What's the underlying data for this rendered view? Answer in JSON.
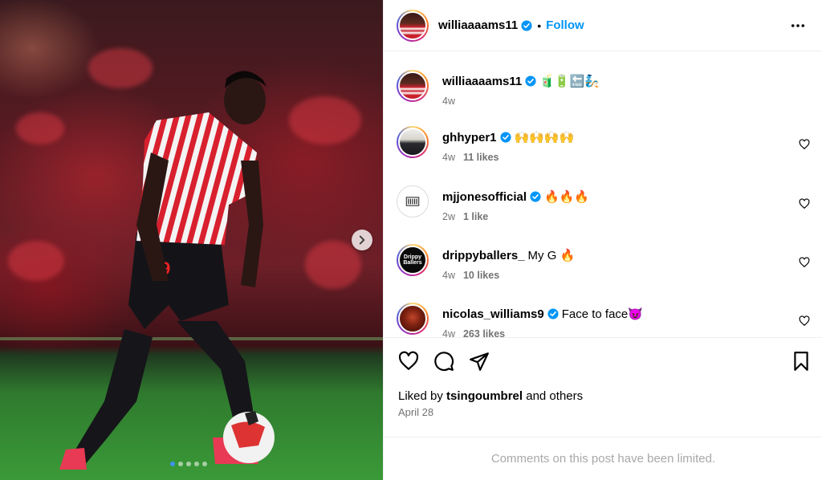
{
  "post": {
    "author": "williaaaams11",
    "follow_label": "Follow",
    "separator": "•",
    "verified_color": "#0095f6",
    "carousel": {
      "slide_count": 5,
      "active_slide": 1
    },
    "caption": {
      "user": "williaaaams11",
      "text": "🧃🔋🔚🧞",
      "time": "4w"
    }
  },
  "comments": [
    {
      "user": "ghhyper1",
      "verified": true,
      "text": "🙌🙌🙌🙌",
      "time": "4w",
      "likes": "11 likes",
      "avatar": "suit"
    },
    {
      "user": "mjjonesofficial",
      "verified": true,
      "text": "🔥🔥🔥",
      "time": "2w",
      "likes": "1 like",
      "avatar": "logo"
    },
    {
      "user": "drippyballers_",
      "verified": false,
      "text": "My G 🔥",
      "time": "4w",
      "likes": "10 likes",
      "avatar": "drippy",
      "avatar_text": "Drippy Ballers"
    },
    {
      "user": "nicolas_williams9",
      "verified": true,
      "text": "Face to face😈",
      "time": "4w",
      "likes": "263 likes",
      "avatar": "nico"
    }
  ],
  "engagement": {
    "liked_by_prefix": "Liked by",
    "liked_by_user": "tsingoumbrel",
    "liked_by_suffix": "and others",
    "date": "April 28"
  },
  "footer": {
    "comments_limited": "Comments on this post have been limited."
  }
}
